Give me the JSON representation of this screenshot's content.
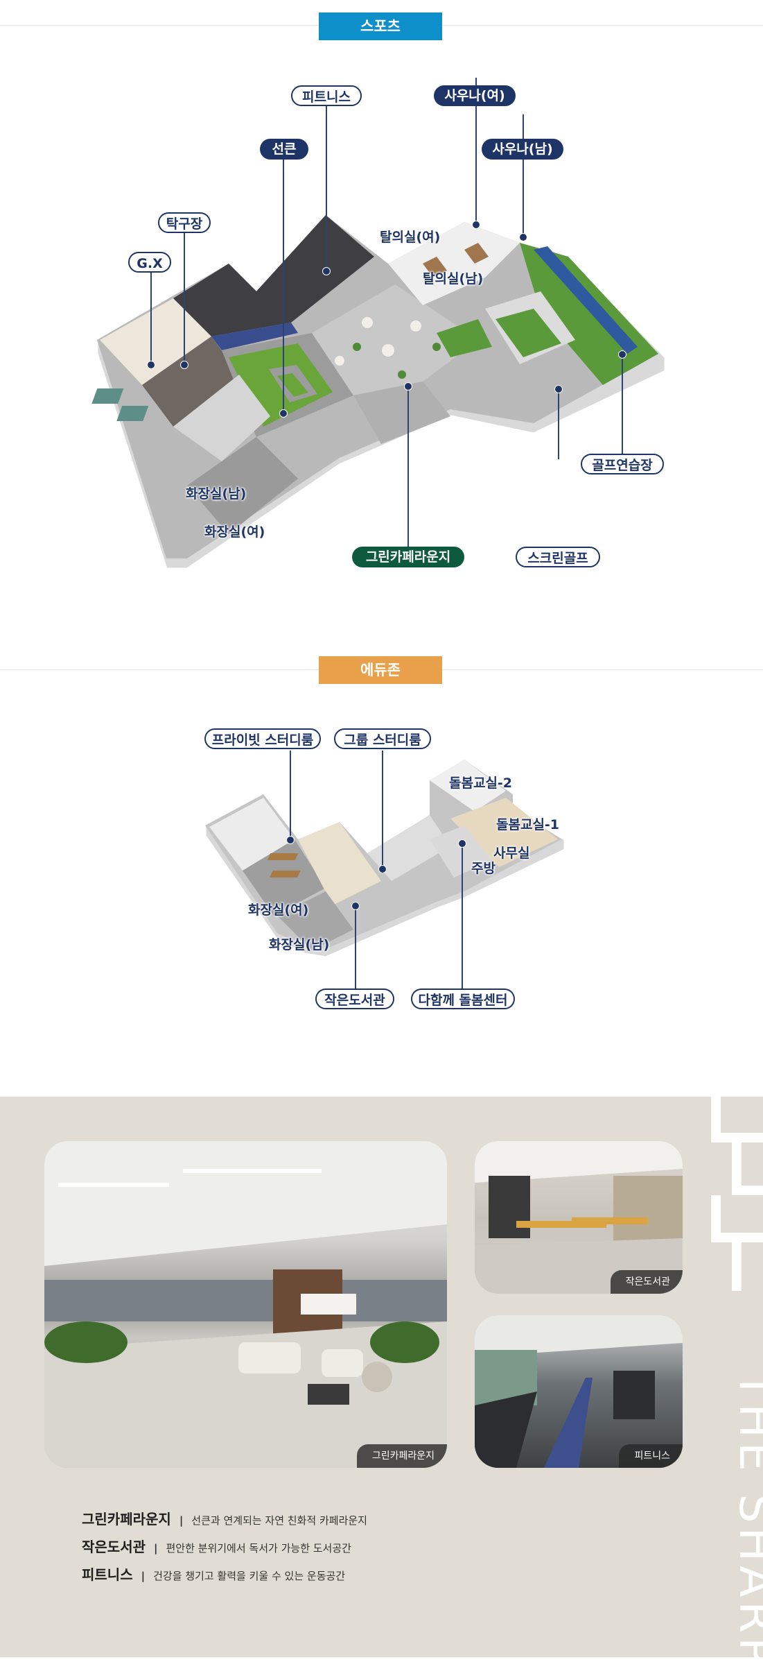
{
  "sports": {
    "title": "스포츠",
    "labels": {
      "fitness": "피트니스",
      "sauna_f": "사우나(여)",
      "sauna_m": "사우나(남)",
      "sunken": "선큰",
      "table_tennis": "탁구장",
      "gx": "G.X",
      "dress_f": "탈의실(여)",
      "dress_m": "탈의실(남)",
      "wc_m": "화장실(남)",
      "wc_f": "화장실(여)",
      "lounge": "그린카페라운지",
      "screen_golf": "스크린골프",
      "golf_practice": "골프연습장"
    }
  },
  "edu": {
    "title": "에듀존",
    "labels": {
      "private_study": "프라이빗 스터디룸",
      "group_study": "그룹 스터디룸",
      "care2": "돌봄교실-2",
      "care1": "돌봄교실-1",
      "office": "사무실",
      "kitchen": "주방",
      "wc_f": "화장실(여)",
      "wc_m": "화장실(남)",
      "library": "작은도서관",
      "care_center": "다함께 돌봄센터"
    }
  },
  "gallery": {
    "brand": "THE SHARP",
    "photos": {
      "lounge": "그린카페라운지",
      "library": "작은도서관",
      "fitness": "피트니스"
    },
    "descriptions": [
      {
        "name": "그린카페라운지",
        "text": "선큰과 연계되는 자연 친화적 카페라운지"
      },
      {
        "name": "작은도서관",
        "text": "편안한 분위기에서 독서가 가능한 도서공간"
      },
      {
        "name": "피트니스",
        "text": "건강을 챙기고 활력을 키울 수 있는 운동공간"
      }
    ]
  },
  "colors": {
    "sports_tab": "#0e8fc9",
    "edu_tab": "#e8a04b",
    "label_navy": "#1f3466",
    "label_green": "#0e5a3e",
    "gallery_bg": "#e2ddd4"
  },
  "icons": [
    "location-dot-icon"
  ]
}
